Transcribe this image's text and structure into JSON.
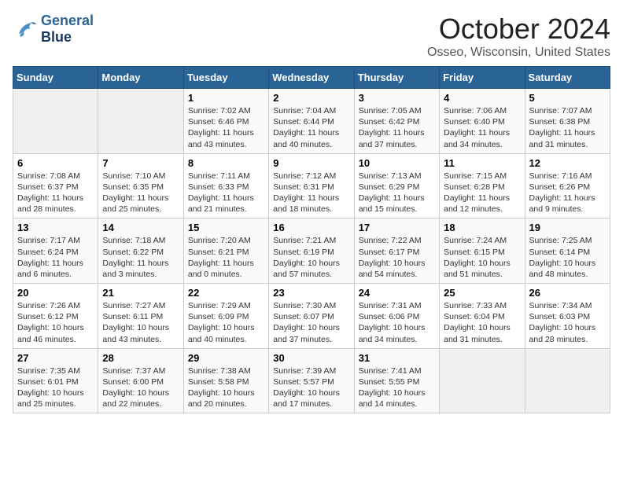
{
  "header": {
    "logo_line1": "General",
    "logo_line2": "Blue",
    "month": "October 2024",
    "location": "Osseo, Wisconsin, United States"
  },
  "days_of_week": [
    "Sunday",
    "Monday",
    "Tuesday",
    "Wednesday",
    "Thursday",
    "Friday",
    "Saturday"
  ],
  "weeks": [
    [
      {
        "day": "",
        "sunrise": "",
        "sunset": "",
        "daylight": ""
      },
      {
        "day": "",
        "sunrise": "",
        "sunset": "",
        "daylight": ""
      },
      {
        "day": "1",
        "sunrise": "Sunrise: 7:02 AM",
        "sunset": "Sunset: 6:46 PM",
        "daylight": "Daylight: 11 hours and 43 minutes."
      },
      {
        "day": "2",
        "sunrise": "Sunrise: 7:04 AM",
        "sunset": "Sunset: 6:44 PM",
        "daylight": "Daylight: 11 hours and 40 minutes."
      },
      {
        "day": "3",
        "sunrise": "Sunrise: 7:05 AM",
        "sunset": "Sunset: 6:42 PM",
        "daylight": "Daylight: 11 hours and 37 minutes."
      },
      {
        "day": "4",
        "sunrise": "Sunrise: 7:06 AM",
        "sunset": "Sunset: 6:40 PM",
        "daylight": "Daylight: 11 hours and 34 minutes."
      },
      {
        "day": "5",
        "sunrise": "Sunrise: 7:07 AM",
        "sunset": "Sunset: 6:38 PM",
        "daylight": "Daylight: 11 hours and 31 minutes."
      }
    ],
    [
      {
        "day": "6",
        "sunrise": "Sunrise: 7:08 AM",
        "sunset": "Sunset: 6:37 PM",
        "daylight": "Daylight: 11 hours and 28 minutes."
      },
      {
        "day": "7",
        "sunrise": "Sunrise: 7:10 AM",
        "sunset": "Sunset: 6:35 PM",
        "daylight": "Daylight: 11 hours and 25 minutes."
      },
      {
        "day": "8",
        "sunrise": "Sunrise: 7:11 AM",
        "sunset": "Sunset: 6:33 PM",
        "daylight": "Daylight: 11 hours and 21 minutes."
      },
      {
        "day": "9",
        "sunrise": "Sunrise: 7:12 AM",
        "sunset": "Sunset: 6:31 PM",
        "daylight": "Daylight: 11 hours and 18 minutes."
      },
      {
        "day": "10",
        "sunrise": "Sunrise: 7:13 AM",
        "sunset": "Sunset: 6:29 PM",
        "daylight": "Daylight: 11 hours and 15 minutes."
      },
      {
        "day": "11",
        "sunrise": "Sunrise: 7:15 AM",
        "sunset": "Sunset: 6:28 PM",
        "daylight": "Daylight: 11 hours and 12 minutes."
      },
      {
        "day": "12",
        "sunrise": "Sunrise: 7:16 AM",
        "sunset": "Sunset: 6:26 PM",
        "daylight": "Daylight: 11 hours and 9 minutes."
      }
    ],
    [
      {
        "day": "13",
        "sunrise": "Sunrise: 7:17 AM",
        "sunset": "Sunset: 6:24 PM",
        "daylight": "Daylight: 11 hours and 6 minutes."
      },
      {
        "day": "14",
        "sunrise": "Sunrise: 7:18 AM",
        "sunset": "Sunset: 6:22 PM",
        "daylight": "Daylight: 11 hours and 3 minutes."
      },
      {
        "day": "15",
        "sunrise": "Sunrise: 7:20 AM",
        "sunset": "Sunset: 6:21 PM",
        "daylight": "Daylight: 11 hours and 0 minutes."
      },
      {
        "day": "16",
        "sunrise": "Sunrise: 7:21 AM",
        "sunset": "Sunset: 6:19 PM",
        "daylight": "Daylight: 10 hours and 57 minutes."
      },
      {
        "day": "17",
        "sunrise": "Sunrise: 7:22 AM",
        "sunset": "Sunset: 6:17 PM",
        "daylight": "Daylight: 10 hours and 54 minutes."
      },
      {
        "day": "18",
        "sunrise": "Sunrise: 7:24 AM",
        "sunset": "Sunset: 6:15 PM",
        "daylight": "Daylight: 10 hours and 51 minutes."
      },
      {
        "day": "19",
        "sunrise": "Sunrise: 7:25 AM",
        "sunset": "Sunset: 6:14 PM",
        "daylight": "Daylight: 10 hours and 48 minutes."
      }
    ],
    [
      {
        "day": "20",
        "sunrise": "Sunrise: 7:26 AM",
        "sunset": "Sunset: 6:12 PM",
        "daylight": "Daylight: 10 hours and 46 minutes."
      },
      {
        "day": "21",
        "sunrise": "Sunrise: 7:27 AM",
        "sunset": "Sunset: 6:11 PM",
        "daylight": "Daylight: 10 hours and 43 minutes."
      },
      {
        "day": "22",
        "sunrise": "Sunrise: 7:29 AM",
        "sunset": "Sunset: 6:09 PM",
        "daylight": "Daylight: 10 hours and 40 minutes."
      },
      {
        "day": "23",
        "sunrise": "Sunrise: 7:30 AM",
        "sunset": "Sunset: 6:07 PM",
        "daylight": "Daylight: 10 hours and 37 minutes."
      },
      {
        "day": "24",
        "sunrise": "Sunrise: 7:31 AM",
        "sunset": "Sunset: 6:06 PM",
        "daylight": "Daylight: 10 hours and 34 minutes."
      },
      {
        "day": "25",
        "sunrise": "Sunrise: 7:33 AM",
        "sunset": "Sunset: 6:04 PM",
        "daylight": "Daylight: 10 hours and 31 minutes."
      },
      {
        "day": "26",
        "sunrise": "Sunrise: 7:34 AM",
        "sunset": "Sunset: 6:03 PM",
        "daylight": "Daylight: 10 hours and 28 minutes."
      }
    ],
    [
      {
        "day": "27",
        "sunrise": "Sunrise: 7:35 AM",
        "sunset": "Sunset: 6:01 PM",
        "daylight": "Daylight: 10 hours and 25 minutes."
      },
      {
        "day": "28",
        "sunrise": "Sunrise: 7:37 AM",
        "sunset": "Sunset: 6:00 PM",
        "daylight": "Daylight: 10 hours and 22 minutes."
      },
      {
        "day": "29",
        "sunrise": "Sunrise: 7:38 AM",
        "sunset": "Sunset: 5:58 PM",
        "daylight": "Daylight: 10 hours and 20 minutes."
      },
      {
        "day": "30",
        "sunrise": "Sunrise: 7:39 AM",
        "sunset": "Sunset: 5:57 PM",
        "daylight": "Daylight: 10 hours and 17 minutes."
      },
      {
        "day": "31",
        "sunrise": "Sunrise: 7:41 AM",
        "sunset": "Sunset: 5:55 PM",
        "daylight": "Daylight: 10 hours and 14 minutes."
      },
      {
        "day": "",
        "sunrise": "",
        "sunset": "",
        "daylight": ""
      },
      {
        "day": "",
        "sunrise": "",
        "sunset": "",
        "daylight": ""
      }
    ]
  ]
}
